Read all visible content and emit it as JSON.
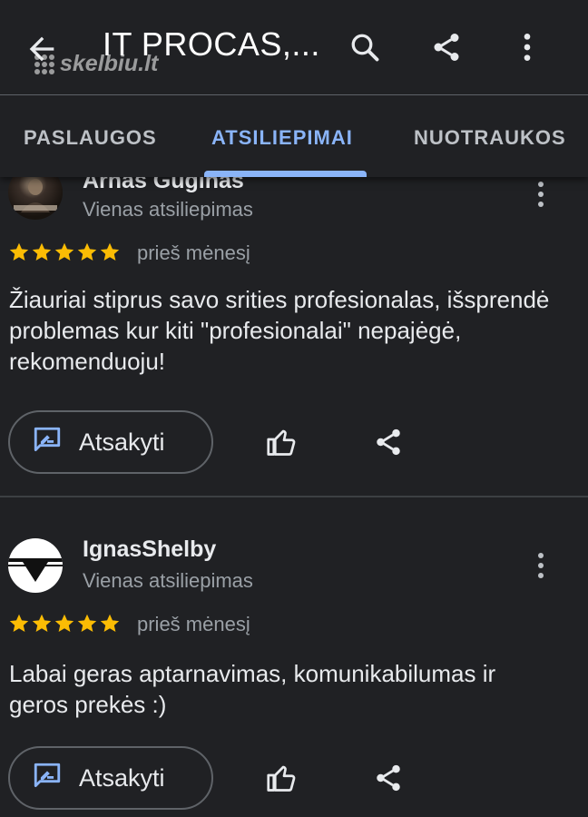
{
  "header": {
    "title": "IT PROCAS,...",
    "watermark": "skelbiu.lt",
    "back_icon": "arrow-back-icon",
    "search_icon": "search-icon",
    "share_icon": "share-icon",
    "more_icon": "more-vert-icon"
  },
  "tabs": [
    {
      "label": "PASLAUGOS",
      "active": false
    },
    {
      "label": "ATSILIEPIMAI",
      "active": true
    },
    {
      "label": "NUOTRAUKOS",
      "active": false
    }
  ],
  "colors": {
    "background": "#202124",
    "accent": "#8ab4f8",
    "star": "#fbbc04",
    "text_primary": "#e8eaed",
    "text_secondary": "#9aa0a6"
  },
  "reviews": [
    {
      "author": "Arnas Guginas",
      "subtitle": "Vienas atsiliepimas",
      "rating": 5,
      "time": "prieš mėnesį",
      "text": "Žiauriai stiprus savo srities profesionalas, išsprendė problemas kur kiti \"profesionalai\" nepajėgė, rekomenduoju!",
      "reply_label": "Atsakyti",
      "avatar": "user-photo-avatar"
    },
    {
      "author": "IgnasShelby",
      "subtitle": "Vienas atsiliepimas",
      "rating": 5,
      "time": "prieš mėnesį",
      "text": "Labai geras aptarnavimas, komunikabilumas ir geros prekės :)",
      "reply_label": "Atsakyti",
      "avatar": "logo-avatar"
    }
  ]
}
